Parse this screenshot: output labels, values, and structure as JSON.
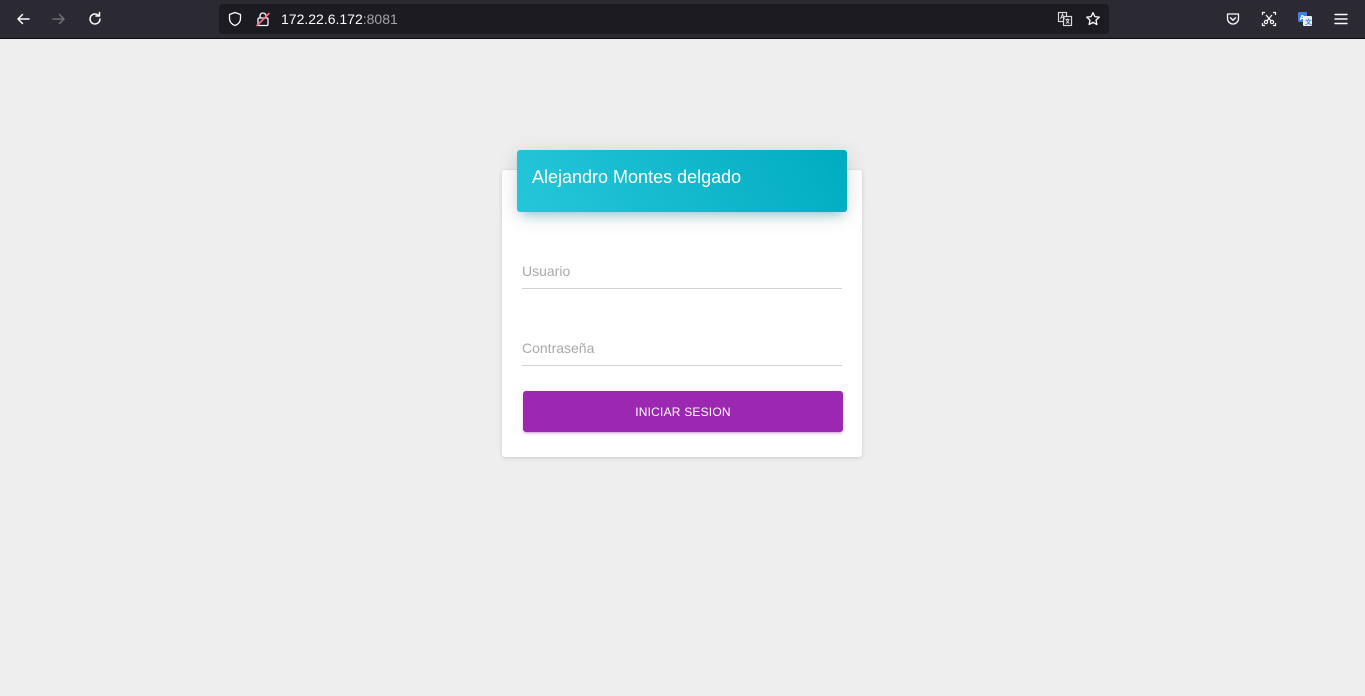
{
  "browser": {
    "url_host": "172.22.6.172",
    "url_port": ":8081",
    "icons": {
      "back": "arrow-left-icon",
      "forward": "arrow-right-icon",
      "reload": "reload-icon",
      "tracking": "shield-icon",
      "lock": "lock-insecure-icon",
      "translate": "translate-icon",
      "bookmark": "star-icon",
      "pocket": "pocket-icon",
      "screenshot": "screenshot-icon",
      "translator_ext": "translator-extension-icon",
      "menu": "hamburger-menu-icon"
    }
  },
  "login": {
    "title": "Alejandro Montes delgado",
    "username_placeholder": "Usuario",
    "username_value": "",
    "password_placeholder": "Contraseña",
    "password_value": "",
    "submit_label": "INICIAR SESION"
  },
  "colors": {
    "header_gradient_start": "#26c6da",
    "header_gradient_end": "#00acc1",
    "button": "#9c27b0",
    "page_background": "#eeeeee"
  }
}
